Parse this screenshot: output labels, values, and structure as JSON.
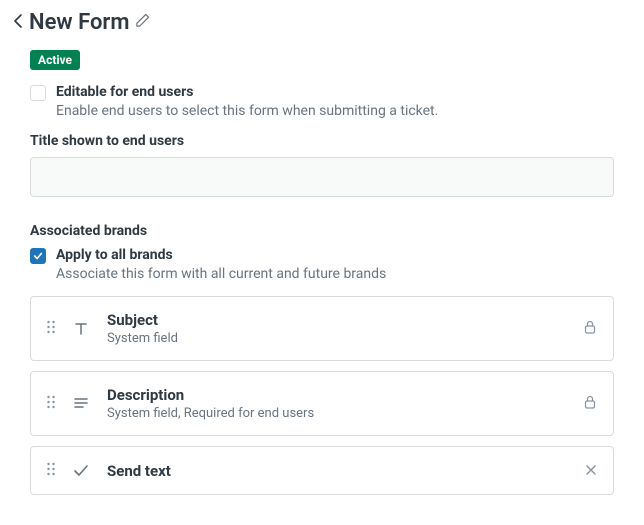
{
  "header": {
    "title": "New Form"
  },
  "status_badge": "Active",
  "editable": {
    "checked": false,
    "label": "Editable for end users",
    "description": "Enable end users to select this form when submitting a ticket."
  },
  "title_section": {
    "label": "Title shown to end users",
    "value": ""
  },
  "brands": {
    "label": "Associated brands",
    "apply_all": {
      "checked": true,
      "label": "Apply to all brands",
      "description": "Associate this form with all current and future brands"
    }
  },
  "fields": [
    {
      "title": "Subject",
      "subtitle": "System field",
      "type_icon": "text",
      "action": "lock"
    },
    {
      "title": "Description",
      "subtitle": "System field, Required for end users",
      "type_icon": "multiline",
      "action": "lock"
    },
    {
      "title": "Send text",
      "subtitle": "",
      "type_icon": "check",
      "action": "close"
    }
  ]
}
